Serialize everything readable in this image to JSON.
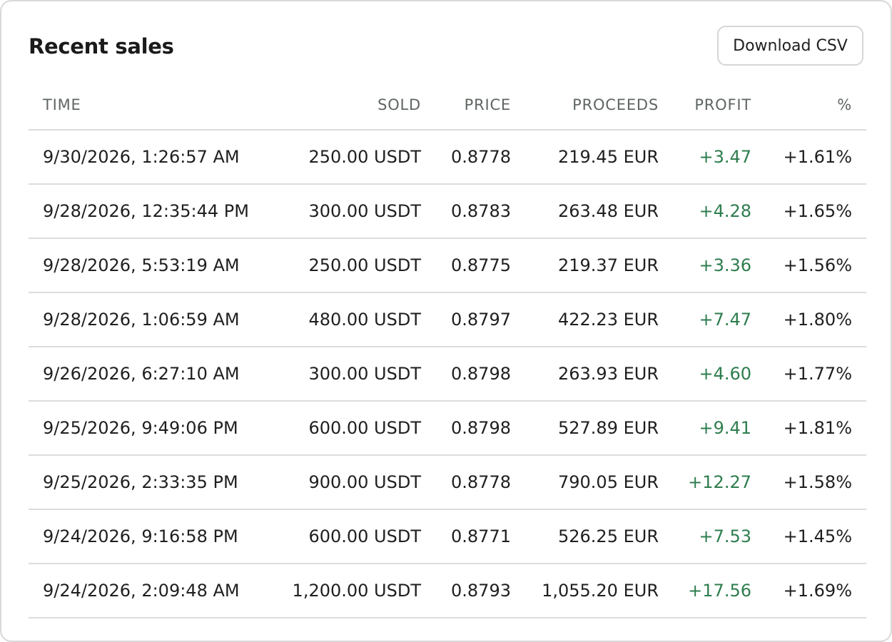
{
  "header": {
    "title": "Recent sales",
    "download_label": "Download CSV"
  },
  "columns": {
    "time": "TIME",
    "sold": "SOLD",
    "price": "PRICE",
    "proceeds": "PROCEEDS",
    "profit": "PROFIT",
    "pct": "%"
  },
  "colors": {
    "profit_positive": "#2e7d4f",
    "border": "#dcdcdc",
    "header_text": "#5f6660"
  },
  "rows": [
    {
      "time": "9/30/2026, 1:26:57 AM",
      "sold": "250.00 USDT",
      "price": "0.8778",
      "proceeds": "219.45 EUR",
      "profit": "+3.47",
      "pct": "+1.61%"
    },
    {
      "time": "9/28/2026, 12:35:44 PM",
      "sold": "300.00 USDT",
      "price": "0.8783",
      "proceeds": "263.48 EUR",
      "profit": "+4.28",
      "pct": "+1.65%"
    },
    {
      "time": "9/28/2026, 5:53:19 AM",
      "sold": "250.00 USDT",
      "price": "0.8775",
      "proceeds": "219.37 EUR",
      "profit": "+3.36",
      "pct": "+1.56%"
    },
    {
      "time": "9/28/2026, 1:06:59 AM",
      "sold": "480.00 USDT",
      "price": "0.8797",
      "proceeds": "422.23 EUR",
      "profit": "+7.47",
      "pct": "+1.80%"
    },
    {
      "time": "9/26/2026, 6:27:10 AM",
      "sold": "300.00 USDT",
      "price": "0.8798",
      "proceeds": "263.93 EUR",
      "profit": "+4.60",
      "pct": "+1.77%"
    },
    {
      "time": "9/25/2026, 9:49:06 PM",
      "sold": "600.00 USDT",
      "price": "0.8798",
      "proceeds": "527.89 EUR",
      "profit": "+9.41",
      "pct": "+1.81%"
    },
    {
      "time": "9/25/2026, 2:33:35 PM",
      "sold": "900.00 USDT",
      "price": "0.8778",
      "proceeds": "790.05 EUR",
      "profit": "+12.27",
      "pct": "+1.58%"
    },
    {
      "time": "9/24/2026, 9:16:58 PM",
      "sold": "600.00 USDT",
      "price": "0.8771",
      "proceeds": "526.25 EUR",
      "profit": "+7.53",
      "pct": "+1.45%"
    },
    {
      "time": "9/24/2026, 2:09:48 AM",
      "sold": "1,200.00 USDT",
      "price": "0.8793",
      "proceeds": "1,055.20 EUR",
      "profit": "+17.56",
      "pct": "+1.69%"
    }
  ]
}
